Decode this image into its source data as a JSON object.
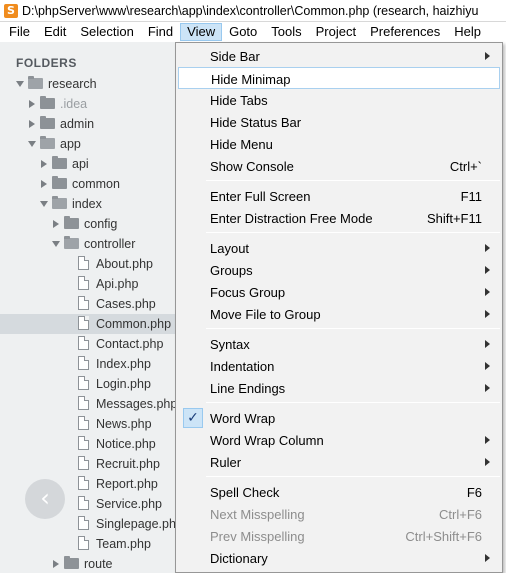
{
  "window": {
    "title": "D:\\phpServer\\www\\research\\app\\index\\controller\\Common.php (research, haizhiyu",
    "app_icon_glyph": "S"
  },
  "menubar": {
    "items": [
      "File",
      "Edit",
      "Selection",
      "Find",
      "View",
      "Goto",
      "Tools",
      "Project",
      "Preferences",
      "Help"
    ],
    "active": "View"
  },
  "sidebar": {
    "header": "FOLDERS",
    "tree": [
      {
        "label": "research",
        "type": "folder",
        "state": "open",
        "depth": 0
      },
      {
        "label": ".idea",
        "type": "folder",
        "state": "closed",
        "depth": 1,
        "muted": true
      },
      {
        "label": "admin",
        "type": "folder",
        "state": "closed",
        "depth": 1
      },
      {
        "label": "app",
        "type": "folder",
        "state": "open",
        "depth": 1
      },
      {
        "label": "api",
        "type": "folder",
        "state": "closed",
        "depth": 2
      },
      {
        "label": "common",
        "type": "folder",
        "state": "closed",
        "depth": 2
      },
      {
        "label": "index",
        "type": "folder",
        "state": "open",
        "depth": 2
      },
      {
        "label": "config",
        "type": "folder",
        "state": "closed",
        "depth": 3
      },
      {
        "label": "controller",
        "type": "folder",
        "state": "open",
        "depth": 3
      },
      {
        "label": "About.php",
        "type": "file",
        "depth": 4
      },
      {
        "label": "Api.php",
        "type": "file",
        "depth": 4
      },
      {
        "label": "Cases.php",
        "type": "file",
        "depth": 4
      },
      {
        "label": "Common.php",
        "type": "file",
        "depth": 4,
        "selected": true
      },
      {
        "label": "Contact.php",
        "type": "file",
        "depth": 4
      },
      {
        "label": "Index.php",
        "type": "file",
        "depth": 4
      },
      {
        "label": "Login.php",
        "type": "file",
        "depth": 4
      },
      {
        "label": "Messages.php",
        "type": "file",
        "depth": 4
      },
      {
        "label": "News.php",
        "type": "file",
        "depth": 4
      },
      {
        "label": "Notice.php",
        "type": "file",
        "depth": 4
      },
      {
        "label": "Recruit.php",
        "type": "file",
        "depth": 4
      },
      {
        "label": "Report.php",
        "type": "file",
        "depth": 4
      },
      {
        "label": "Service.php",
        "type": "file",
        "depth": 4
      },
      {
        "label": "Singlepage.php",
        "type": "file",
        "depth": 4
      },
      {
        "label": "Team.php",
        "type": "file",
        "depth": 4
      },
      {
        "label": "route",
        "type": "folder",
        "state": "closed",
        "depth": 3
      }
    ],
    "back_button_glyph": "‹"
  },
  "view_menu": {
    "groups": [
      [
        {
          "label": "Side Bar",
          "submenu": true
        },
        {
          "label": "Hide Minimap",
          "hover": true
        },
        {
          "label": "Hide Tabs"
        },
        {
          "label": "Hide Status Bar"
        },
        {
          "label": "Hide Menu"
        },
        {
          "label": "Show Console",
          "shortcut": "Ctrl+`"
        }
      ],
      [
        {
          "label": "Enter Full Screen",
          "shortcut": "F11"
        },
        {
          "label": "Enter Distraction Free Mode",
          "shortcut": "Shift+F11"
        }
      ],
      [
        {
          "label": "Layout",
          "submenu": true
        },
        {
          "label": "Groups",
          "submenu": true
        },
        {
          "label": "Focus Group",
          "submenu": true
        },
        {
          "label": "Move File to Group",
          "submenu": true
        }
      ],
      [
        {
          "label": "Syntax",
          "submenu": true
        },
        {
          "label": "Indentation",
          "submenu": true
        },
        {
          "label": "Line Endings",
          "submenu": true
        }
      ],
      [
        {
          "label": "Word Wrap",
          "checked": true
        },
        {
          "label": "Word Wrap Column",
          "submenu": true
        },
        {
          "label": "Ruler",
          "submenu": true
        }
      ],
      [
        {
          "label": "Spell Check",
          "shortcut": "F6"
        },
        {
          "label": "Next Misspelling",
          "shortcut": "Ctrl+F6",
          "disabled": true
        },
        {
          "label": "Prev Misspelling",
          "shortcut": "Ctrl+Shift+F6",
          "disabled": true
        },
        {
          "label": "Dictionary",
          "submenu": true
        }
      ]
    ],
    "check_glyph": "✓"
  },
  "colors": {
    "menu_active_bg": "#cce4f7",
    "sidebar_bg": "#eef0f1",
    "selected_row_bg": "#d5dade",
    "dropdown_bg": "#f2f2f2",
    "app_icon": "#f08c1e"
  }
}
